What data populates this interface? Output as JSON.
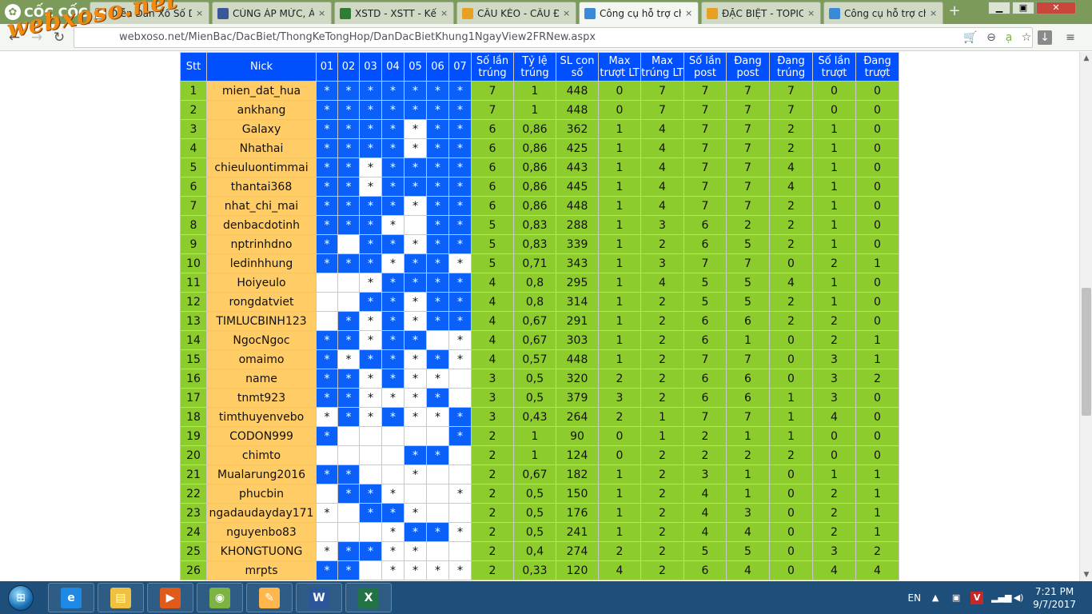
{
  "browser": {
    "brand": "CỐC CỐC",
    "tabs": [
      {
        "label": "Diễn Đàn Xổ Số Dự...",
        "icon": "doc-icon",
        "color": "#ffffff",
        "active": false
      },
      {
        "label": "CÙNG ÁP MỨC, ÁP...",
        "icon": "facebook-icon",
        "color": "#3b5998",
        "active": false
      },
      {
        "label": "XSTD - XSTT - Kết...",
        "icon": "chrome-icon",
        "color": "#2e7d32",
        "active": false
      },
      {
        "label": "CẦU KÈO - CẦU ĐỀ...",
        "icon": "xs-icon",
        "color": "#e8a020",
        "active": false
      },
      {
        "label": "Công cụ hỗ trợ chơ...",
        "icon": "tool-icon",
        "color": "#3a8ad8",
        "active": true
      },
      {
        "label": "ĐẶC BIỆT - TOPIC...",
        "icon": "xs-icon",
        "color": "#e8a020",
        "active": false
      },
      {
        "label": "Công cụ hỗ trợ chơ...",
        "icon": "tool-icon",
        "color": "#3a8ad8",
        "active": false
      }
    ],
    "url": "webxoso.net/MienBac/DacBiet/ThongKeTongHop/DanDacBietKhung1NgayView2FRNew.aspx",
    "watermark": "webxoso.net"
  },
  "table": {
    "headers": [
      "Stt",
      "Nick",
      "01",
      "02",
      "03",
      "04",
      "05",
      "06",
      "07",
      "Số lần trúng",
      "Tỷ lệ trúng",
      "SL con số",
      "Max trượt LT",
      "Max trúng LT",
      "Số lần post",
      "Đang post",
      "Đang trúng",
      "Số lần trượt",
      "Đang trượt"
    ],
    "rows": [
      {
        "stt": "1",
        "nick": "mien_dat_hua",
        "marks": [
          [
            1,
            1
          ],
          [
            1,
            1
          ],
          [
            1,
            1
          ],
          [
            1,
            1
          ],
          [
            1,
            1
          ],
          [
            1,
            1
          ],
          [
            1,
            1
          ]
        ],
        "stats": [
          "7",
          "1",
          "448",
          "0",
          "7",
          "7",
          "7",
          "7",
          "0",
          "0"
        ]
      },
      {
        "stt": "2",
        "nick": "ankhang",
        "marks": [
          [
            1,
            1
          ],
          [
            1,
            1
          ],
          [
            1,
            1
          ],
          [
            1,
            1
          ],
          [
            1,
            1
          ],
          [
            1,
            1
          ],
          [
            1,
            1
          ]
        ],
        "stats": [
          "7",
          "1",
          "448",
          "0",
          "7",
          "7",
          "7",
          "7",
          "0",
          "0"
        ]
      },
      {
        "stt": "3",
        "nick": "Galaxy",
        "marks": [
          [
            1,
            1
          ],
          [
            1,
            1
          ],
          [
            1,
            1
          ],
          [
            1,
            1
          ],
          [
            1,
            0
          ],
          [
            1,
            1
          ],
          [
            1,
            1
          ]
        ],
        "stats": [
          "6",
          "0,86",
          "362",
          "1",
          "4",
          "7",
          "7",
          "2",
          "1",
          "0"
        ]
      },
      {
        "stt": "4",
        "nick": "Nhathai",
        "marks": [
          [
            1,
            1
          ],
          [
            1,
            1
          ],
          [
            1,
            1
          ],
          [
            1,
            1
          ],
          [
            1,
            0
          ],
          [
            1,
            1
          ],
          [
            1,
            1
          ]
        ],
        "stats": [
          "6",
          "0,86",
          "425",
          "1",
          "4",
          "7",
          "7",
          "2",
          "1",
          "0"
        ]
      },
      {
        "stt": "5",
        "nick": "chieuluontimmai",
        "marks": [
          [
            1,
            1
          ],
          [
            1,
            1
          ],
          [
            1,
            0
          ],
          [
            1,
            1
          ],
          [
            1,
            1
          ],
          [
            1,
            1
          ],
          [
            1,
            1
          ]
        ],
        "stats": [
          "6",
          "0,86",
          "443",
          "1",
          "4",
          "7",
          "7",
          "4",
          "1",
          "0"
        ]
      },
      {
        "stt": "6",
        "nick": "thantai368",
        "marks": [
          [
            1,
            1
          ],
          [
            1,
            1
          ],
          [
            1,
            0
          ],
          [
            1,
            1
          ],
          [
            1,
            1
          ],
          [
            1,
            1
          ],
          [
            1,
            1
          ]
        ],
        "stats": [
          "6",
          "0,86",
          "445",
          "1",
          "4",
          "7",
          "7",
          "4",
          "1",
          "0"
        ]
      },
      {
        "stt": "7",
        "nick": "nhat_chi_mai",
        "marks": [
          [
            1,
            1
          ],
          [
            1,
            1
          ],
          [
            1,
            1
          ],
          [
            1,
            1
          ],
          [
            1,
            0
          ],
          [
            1,
            1
          ],
          [
            1,
            1
          ]
        ],
        "stats": [
          "6",
          "0,86",
          "448",
          "1",
          "4",
          "7",
          "7",
          "2",
          "1",
          "0"
        ]
      },
      {
        "stt": "8",
        "nick": "denbacdotinh",
        "marks": [
          [
            1,
            1
          ],
          [
            1,
            1
          ],
          [
            1,
            1
          ],
          [
            1,
            0
          ],
          [
            0,
            0
          ],
          [
            1,
            1
          ],
          [
            1,
            1
          ]
        ],
        "stats": [
          "5",
          "0,83",
          "288",
          "1",
          "3",
          "6",
          "2",
          "2",
          "1",
          "0"
        ]
      },
      {
        "stt": "9",
        "nick": "nptrinhdno",
        "marks": [
          [
            1,
            1
          ],
          [
            0,
            0
          ],
          [
            1,
            1
          ],
          [
            1,
            1
          ],
          [
            1,
            0
          ],
          [
            1,
            1
          ],
          [
            1,
            1
          ]
        ],
        "stats": [
          "5",
          "0,83",
          "339",
          "1",
          "2",
          "6",
          "5",
          "2",
          "1",
          "0"
        ]
      },
      {
        "stt": "10",
        "nick": "ledinhhung",
        "marks": [
          [
            1,
            1
          ],
          [
            1,
            1
          ],
          [
            1,
            1
          ],
          [
            1,
            0
          ],
          [
            1,
            1
          ],
          [
            1,
            1
          ],
          [
            1,
            0
          ]
        ],
        "stats": [
          "5",
          "0,71",
          "343",
          "1",
          "3",
          "7",
          "7",
          "0",
          "2",
          "1"
        ]
      },
      {
        "stt": "11",
        "nick": "Hoiyeulo",
        "marks": [
          [
            0,
            0
          ],
          [
            0,
            0
          ],
          [
            1,
            0
          ],
          [
            1,
            1
          ],
          [
            1,
            1
          ],
          [
            1,
            1
          ],
          [
            1,
            1
          ]
        ],
        "stats": [
          "4",
          "0,8",
          "295",
          "1",
          "4",
          "5",
          "5",
          "4",
          "1",
          "0"
        ]
      },
      {
        "stt": "12",
        "nick": "rongdatviet",
        "marks": [
          [
            0,
            0
          ],
          [
            0,
            0
          ],
          [
            1,
            1
          ],
          [
            1,
            1
          ],
          [
            1,
            0
          ],
          [
            1,
            1
          ],
          [
            1,
            1
          ]
        ],
        "stats": [
          "4",
          "0,8",
          "314",
          "1",
          "2",
          "5",
          "5",
          "2",
          "1",
          "0"
        ]
      },
      {
        "stt": "13",
        "nick": "TIMLUCBINH123",
        "marks": [
          [
            0,
            0
          ],
          [
            1,
            1
          ],
          [
            1,
            0
          ],
          [
            1,
            1
          ],
          [
            1,
            0
          ],
          [
            1,
            1
          ],
          [
            1,
            1
          ]
        ],
        "stats": [
          "4",
          "0,67",
          "291",
          "1",
          "2",
          "6",
          "6",
          "2",
          "2",
          "0"
        ]
      },
      {
        "stt": "14",
        "nick": "NgocNgoc",
        "marks": [
          [
            1,
            1
          ],
          [
            1,
            1
          ],
          [
            1,
            0
          ],
          [
            1,
            1
          ],
          [
            1,
            1
          ],
          [
            0,
            0
          ],
          [
            1,
            0
          ]
        ],
        "stats": [
          "4",
          "0,67",
          "303",
          "1",
          "2",
          "6",
          "1",
          "0",
          "2",
          "1"
        ]
      },
      {
        "stt": "15",
        "nick": "omaimo",
        "marks": [
          [
            1,
            1
          ],
          [
            1,
            0
          ],
          [
            1,
            1
          ],
          [
            1,
            1
          ],
          [
            1,
            0
          ],
          [
            1,
            1
          ],
          [
            1,
            0
          ]
        ],
        "stats": [
          "4",
          "0,57",
          "448",
          "1",
          "2",
          "7",
          "7",
          "0",
          "3",
          "1"
        ]
      },
      {
        "stt": "16",
        "nick": "name",
        "marks": [
          [
            1,
            1
          ],
          [
            1,
            1
          ],
          [
            1,
            0
          ],
          [
            1,
            1
          ],
          [
            1,
            0
          ],
          [
            1,
            0
          ],
          [
            0,
            0
          ]
        ],
        "stats": [
          "3",
          "0,5",
          "320",
          "2",
          "2",
          "6",
          "6",
          "0",
          "3",
          "2"
        ]
      },
      {
        "stt": "17",
        "nick": "tnmt923",
        "marks": [
          [
            1,
            1
          ],
          [
            1,
            1
          ],
          [
            1,
            0
          ],
          [
            1,
            0
          ],
          [
            1,
            0
          ],
          [
            1,
            1
          ],
          [
            0,
            0
          ]
        ],
        "stats": [
          "3",
          "0,5",
          "379",
          "3",
          "2",
          "6",
          "6",
          "1",
          "3",
          "0"
        ]
      },
      {
        "stt": "18",
        "nick": "timthuyenvebo",
        "marks": [
          [
            1,
            0
          ],
          [
            1,
            1
          ],
          [
            1,
            0
          ],
          [
            1,
            1
          ],
          [
            1,
            0
          ],
          [
            1,
            0
          ],
          [
            1,
            1
          ]
        ],
        "stats": [
          "3",
          "0,43",
          "264",
          "2",
          "1",
          "7",
          "7",
          "1",
          "4",
          "0"
        ]
      },
      {
        "stt": "19",
        "nick": "CODON999",
        "marks": [
          [
            1,
            1
          ],
          [
            0,
            0
          ],
          [
            0,
            0
          ],
          [
            0,
            0
          ],
          [
            0,
            0
          ],
          [
            0,
            0
          ],
          [
            1,
            1
          ]
        ],
        "stats": [
          "2",
          "1",
          "90",
          "0",
          "1",
          "2",
          "1",
          "1",
          "0",
          "0"
        ]
      },
      {
        "stt": "20",
        "nick": "chimto",
        "marks": [
          [
            0,
            0
          ],
          [
            0,
            0
          ],
          [
            0,
            0
          ],
          [
            0,
            0
          ],
          [
            1,
            1
          ],
          [
            1,
            1
          ],
          [
            0,
            0
          ]
        ],
        "stats": [
          "2",
          "1",
          "124",
          "0",
          "2",
          "2",
          "2",
          "2",
          "0",
          "0"
        ]
      },
      {
        "stt": "21",
        "nick": "Mualarung2016",
        "marks": [
          [
            1,
            1
          ],
          [
            1,
            1
          ],
          [
            0,
            0
          ],
          [
            0,
            0
          ],
          [
            1,
            0
          ],
          [
            0,
            0
          ],
          [
            0,
            0
          ]
        ],
        "stats": [
          "2",
          "0,67",
          "182",
          "1",
          "2",
          "3",
          "1",
          "0",
          "1",
          "1"
        ]
      },
      {
        "stt": "22",
        "nick": "phucbin",
        "marks": [
          [
            0,
            0
          ],
          [
            1,
            1
          ],
          [
            1,
            1
          ],
          [
            1,
            0
          ],
          [
            0,
            0
          ],
          [
            0,
            0
          ],
          [
            1,
            0
          ]
        ],
        "stats": [
          "2",
          "0,5",
          "150",
          "1",
          "2",
          "4",
          "1",
          "0",
          "2",
          "1"
        ]
      },
      {
        "stt": "23",
        "nick": "ngadaudayday171",
        "marks": [
          [
            1,
            0
          ],
          [
            0,
            0
          ],
          [
            1,
            1
          ],
          [
            1,
            1
          ],
          [
            1,
            0
          ],
          [
            0,
            0
          ],
          [
            0,
            0
          ]
        ],
        "stats": [
          "2",
          "0,5",
          "176",
          "1",
          "2",
          "4",
          "3",
          "0",
          "2",
          "1"
        ]
      },
      {
        "stt": "24",
        "nick": "nguyenbo83",
        "marks": [
          [
            0,
            0
          ],
          [
            0,
            0
          ],
          [
            0,
            0
          ],
          [
            1,
            0
          ],
          [
            1,
            1
          ],
          [
            1,
            1
          ],
          [
            1,
            0
          ]
        ],
        "stats": [
          "2",
          "0,5",
          "241",
          "1",
          "2",
          "4",
          "4",
          "0",
          "2",
          "1"
        ]
      },
      {
        "stt": "25",
        "nick": "KHONGTUONG",
        "marks": [
          [
            1,
            0
          ],
          [
            1,
            1
          ],
          [
            1,
            1
          ],
          [
            1,
            0
          ],
          [
            1,
            0
          ],
          [
            0,
            0
          ],
          [
            0,
            0
          ]
        ],
        "stats": [
          "2",
          "0,4",
          "274",
          "2",
          "2",
          "5",
          "5",
          "0",
          "3",
          "2"
        ]
      },
      {
        "stt": "26",
        "nick": "mrpts",
        "marks": [
          [
            1,
            1
          ],
          [
            1,
            1
          ],
          [
            0,
            0
          ],
          [
            1,
            0
          ],
          [
            1,
            0
          ],
          [
            1,
            0
          ],
          [
            1,
            0
          ]
        ],
        "stats": [
          "2",
          "0,33",
          "120",
          "4",
          "2",
          "6",
          "4",
          "0",
          "4",
          "4"
        ]
      }
    ]
  },
  "taskbar": {
    "apps": [
      {
        "name": "ie-icon",
        "label": "e",
        "color": "#1e88e5"
      },
      {
        "name": "explorer-icon",
        "label": "▤",
        "color": "#f0c040"
      },
      {
        "name": "media-player-icon",
        "label": "▶",
        "color": "#e05a1c"
      },
      {
        "name": "coccoc-icon",
        "label": "◉",
        "color": "#7cb342"
      },
      {
        "name": "paint-icon",
        "label": "✎",
        "color": "#ffb74d"
      },
      {
        "name": "word-icon",
        "label": "W",
        "color": "#2b579a"
      },
      {
        "name": "excel-icon",
        "label": "X",
        "color": "#217346"
      }
    ],
    "language": "EN",
    "time": "7:21 PM",
    "date": "9/7/2017"
  }
}
